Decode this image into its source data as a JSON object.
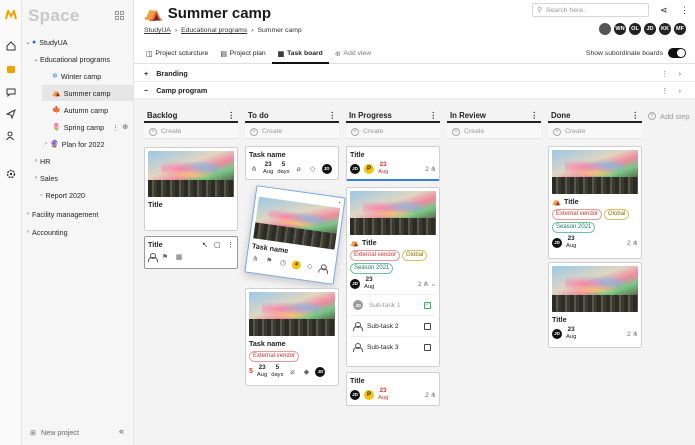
{
  "app": {
    "logo": "Space"
  },
  "sidebar": {
    "workspace": "StudyUA",
    "items": [
      {
        "label": "Educational programs",
        "emoji": ""
      },
      {
        "label": "Winter camp",
        "emoji": "❄"
      },
      {
        "label": "Summer camp",
        "emoji": "⛺"
      },
      {
        "label": "Autumn camp",
        "emoji": "🍁"
      },
      {
        "label": "Spring camp",
        "emoji": "🌷"
      },
      {
        "label": "Plan for 2022",
        "emoji": "🔮"
      },
      {
        "label": "HR"
      },
      {
        "label": "Sales"
      },
      {
        "label": "Report 2020"
      },
      {
        "label": "Facility management"
      },
      {
        "label": "Accounting"
      }
    ],
    "new_project": "New project"
  },
  "header": {
    "title": "Summer camp",
    "title_emoji": "⛺",
    "breadcrumb": [
      "StudyUA",
      "Educational programs",
      "Summer camp"
    ],
    "search_placeholder": "Search here..",
    "avatars": [
      "",
      "WN",
      "OL",
      "JD",
      "KK",
      "MF"
    ]
  },
  "tabs": [
    {
      "label": "Project scturcture",
      "icon": "◫"
    },
    {
      "label": "Project plan",
      "icon": "▤"
    },
    {
      "label": "Task board",
      "icon": "▦"
    },
    {
      "label": "Add view",
      "icon": "⊕"
    }
  ],
  "toggle_label": "Show subordinate boards",
  "groups": [
    {
      "sign": "+",
      "label": "Branding"
    },
    {
      "sign": "−",
      "label": "Camp program"
    }
  ],
  "board": {
    "create_label": "Create",
    "add_step": "Add step",
    "columns": [
      "Backlog",
      "To do",
      "In Progress",
      "In Review",
      "Done"
    ]
  },
  "cards": {
    "backlog_1": {
      "title": "Title"
    },
    "backlog_2": {
      "title": "Title"
    },
    "todo_1": {
      "title": "Task name",
      "day": "23",
      "mon": "Aug",
      "days_n": "5",
      "days_l": "days",
      "user": "JD"
    },
    "todo_drag": {
      "title": "Task name",
      "badge": "4",
      "user": "JD"
    },
    "todo_2": {
      "title": "Task name",
      "tag": "External vendor",
      "prio": "5",
      "day": "23",
      "mon": "Aug",
      "days_n": "5",
      "days_l": "days",
      "user": "JD"
    },
    "ip_1": {
      "title": "Title",
      "user": "JD",
      "flag": "P",
      "day": "23",
      "mon": "Aug",
      "count": "2"
    },
    "ip_2": {
      "title": "Title",
      "tags": [
        "External vendor",
        "Global",
        "Season 2021"
      ],
      "user": "JD",
      "day": "23",
      "mon": "Aug",
      "count": "2",
      "subtasks": [
        "Sub-task 1",
        "Sub-task 2",
        "Sub-task 3"
      ]
    },
    "ip_3": {
      "title": "Title",
      "user": "JD",
      "flag": "P",
      "day": "23",
      "mon": "Aug",
      "count": "2"
    },
    "done_1": {
      "title": "Title",
      "tags": [
        "External vendor",
        "Global",
        "Season 2021"
      ],
      "user": "JD",
      "day": "23",
      "mon": "Aug",
      "count": "2"
    },
    "done_2": {
      "title": "Title",
      "user": "JD",
      "day": "23",
      "mon": "Aug",
      "count": "2"
    }
  }
}
